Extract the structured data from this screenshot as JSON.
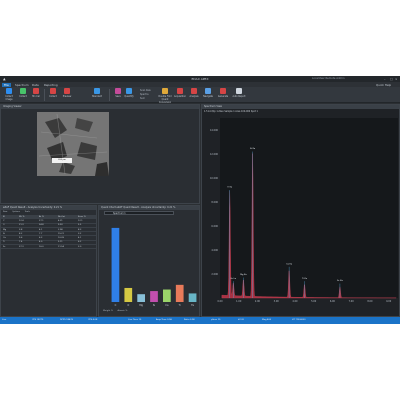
{
  "window": {
    "title": "EDAX APEX",
    "user_label": "LocalUser Remote Admin"
  },
  "tabs": [
    "File",
    "Spectrum",
    "Data",
    "Reporting"
  ],
  "help_label": "Quick Help",
  "ribbon": {
    "buttons": [
      "Collect Image",
      "Collect",
      "Mn Cal",
      "Collect",
      "Preview",
      "Standard",
      "Save",
      "Quantify",
      "Live Time",
      "Report"
    ],
    "checks": [
      "Scan Raw",
      "Spectra",
      "Sum"
    ],
    "group_labels": [
      "Double Fold Quant Conversion",
      "Acquisition",
      "Analysis"
    ],
    "side_buttons": [
      "Navigate",
      "Generate",
      "Auto Report"
    ]
  },
  "panels": {
    "image_title": "Imaging Viewer",
    "scale_label": "200 µm",
    "results_title": "eZAF Quant Result - Analysis Uncertainty: 0.21 %",
    "chart_title": "Quant Chart eZAF Quant Result - Analysis Uncertainty: 0.21 %",
    "spectrum_title": "Spectrum View",
    "spectrum_header": "1.5 kcnt/ip 1.2kev Sample 1 Area 100-000 Spot 1",
    "spectrum_label": "Spectrum 1",
    "chart_tabs": [
      "Weight %",
      "Atomic %"
    ]
  },
  "table": {
    "headers": [
      "El",
      "Wt %",
      "At %",
      "Net Int",
      "Error %"
    ],
    "rows": [
      [
        "C",
        "12.4",
        "27.1",
        "4.21",
        "12.1"
      ],
      [
        "O",
        "21.3",
        "34.8",
        "9.93",
        "5.5"
      ],
      [
        "Mg",
        "3.8",
        "4.1",
        "2.98",
        "8.3"
      ],
      [
        "Si",
        "8.2",
        "7.7",
        "15.21",
        "3.2"
      ],
      [
        "Ca",
        "9.6",
        "6.3",
        "10.09",
        "4.1"
      ],
      [
        "Ti",
        "7.4",
        "4.0",
        "5.11",
        "6.2"
      ],
      [
        "Fe",
        "37.3",
        "16.0",
        "11.54",
        "3.0"
      ]
    ],
    "toolbar": [
      "Row",
      "Options",
      "Tools"
    ]
  },
  "chart_data": [
    {
      "type": "bar",
      "categories": [
        "C",
        "O",
        "Mg",
        "Si",
        "Ca",
        "Ti",
        "Fe"
      ],
      "values": [
        95,
        18,
        10,
        14,
        16,
        22,
        11
      ],
      "colors": [
        "#2f7fe8",
        "#d6c943",
        "#88c0d8",
        "#c24fae",
        "#9ad56a",
        "#e87a5a",
        "#68b6c7"
      ]
    },
    {
      "type": "line",
      "x_ticks": [
        "0.00",
        "1.00",
        "2.00",
        "3.00",
        "4.00",
        "5.00",
        "6.00",
        "7.00",
        "8.00",
        "9.00"
      ],
      "y_ticks": [
        "14.000",
        "12.000",
        "10.000",
        "8.000",
        "6.000",
        "4.000",
        "2.000"
      ],
      "peaks": [
        {
          "label": "O Ka",
          "x": 0.52,
          "y": 8.7
        },
        {
          "label": "Fe La",
          "x": 0.71,
          "y": 1.1
        },
        {
          "label": "Mg Ka",
          "x": 1.25,
          "y": 1.4
        },
        {
          "label": "Si Ka",
          "x": 1.74,
          "y": 11.9
        },
        {
          "label": "Ca Ka",
          "x": 3.69,
          "y": 2.3
        },
        {
          "label": "Ti Ka",
          "x": 4.51,
          "y": 1.1
        },
        {
          "label": "Fe Ka",
          "x": 6.4,
          "y": 0.9
        }
      ]
    }
  ],
  "statusbar": [
    "Live",
    "CPS 18275",
    "DCPS 18476",
    "CPS 4.08",
    "Live Time 15",
    "Amp Time 0.96",
    "Ratio 0.98",
    "µSecs 15",
    "kV 20",
    "Mag 400",
    "HT 718.4000"
  ]
}
